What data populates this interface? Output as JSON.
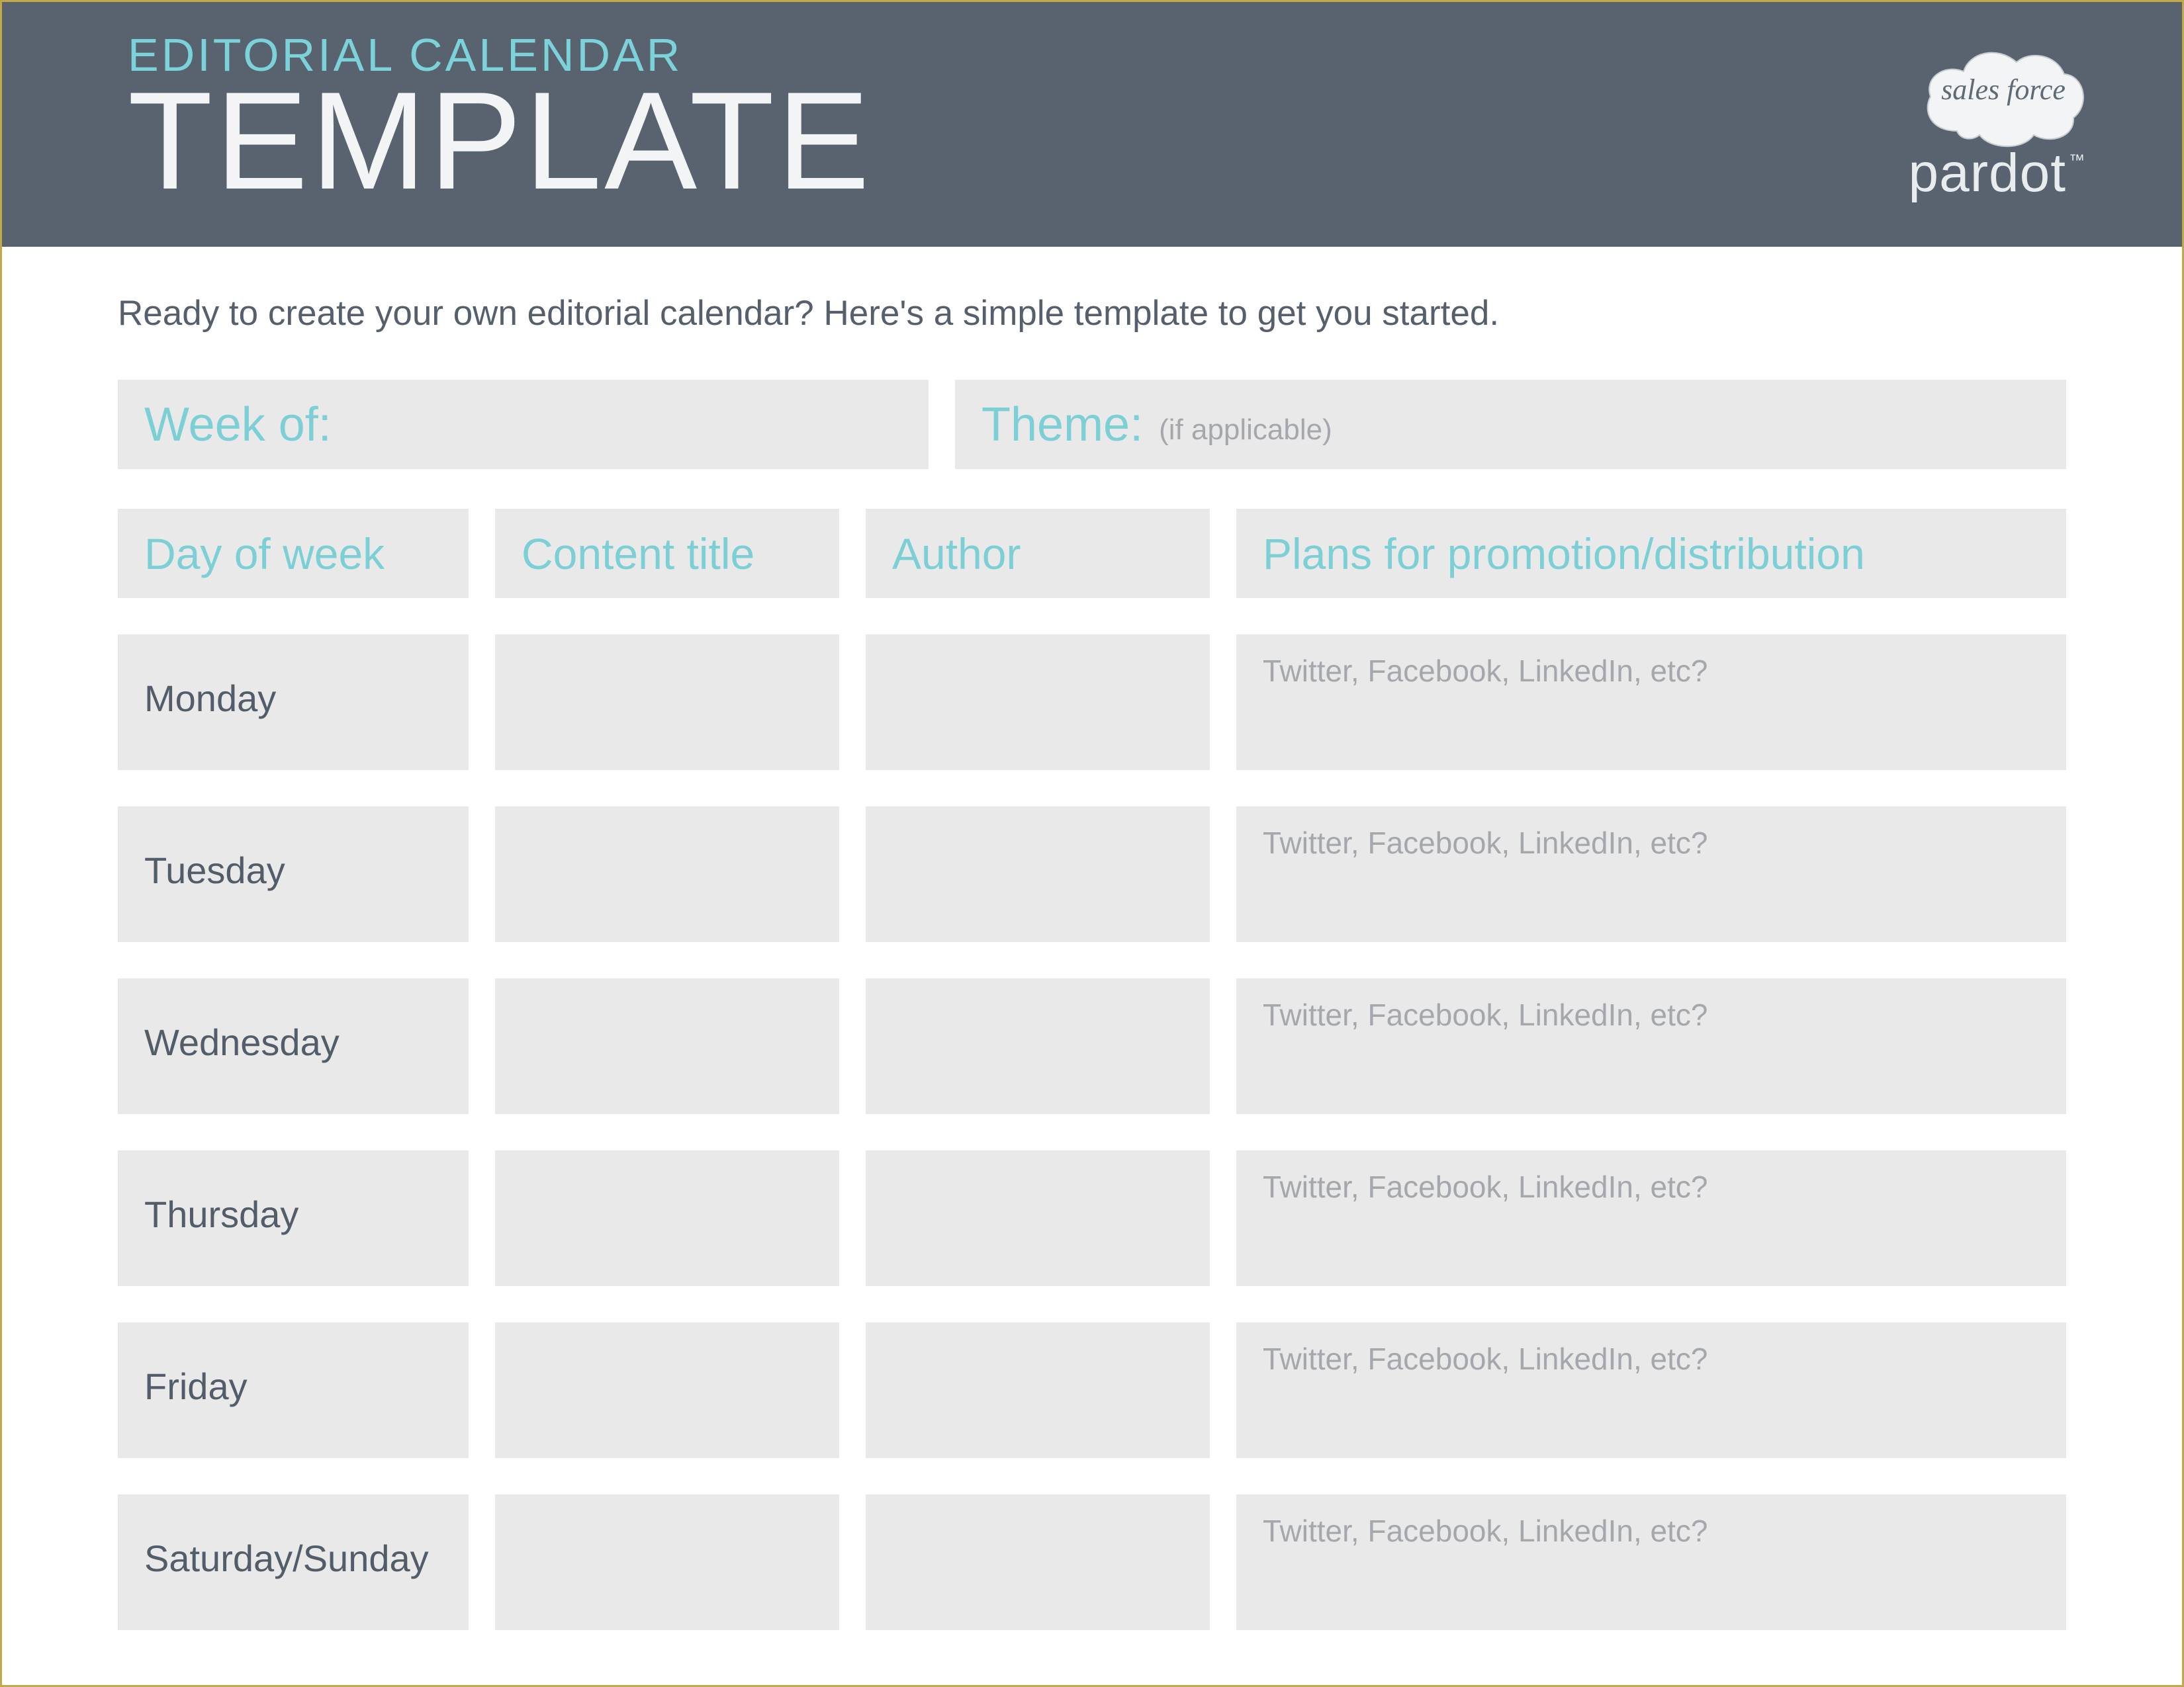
{
  "header": {
    "sup": "EDITORIAL CALENDAR",
    "title": "TEMPLATE"
  },
  "logo": {
    "brand_top": "salesforce",
    "brand_bottom": "pardot",
    "tm": "™"
  },
  "intro": "Ready to create your own editorial calendar? Here's a simple template to get you started.",
  "meta": {
    "week_label": "Week of:",
    "theme_label": "Theme:",
    "theme_hint": "(if applicable)"
  },
  "columns": {
    "day": "Day of week",
    "title": "Content title",
    "author": "Author",
    "plans": "Plans for promotion/distribution"
  },
  "rows": [
    {
      "day": "Monday",
      "title": "",
      "author": "",
      "plans": "Twitter, Facebook, LinkedIn, etc?"
    },
    {
      "day": "Tuesday",
      "title": "",
      "author": "",
      "plans": "Twitter, Facebook, LinkedIn, etc?"
    },
    {
      "day": "Wednesday",
      "title": "",
      "author": "",
      "plans": "Twitter, Facebook, LinkedIn, etc?"
    },
    {
      "day": "Thursday",
      "title": "",
      "author": "",
      "plans": "Twitter, Facebook, LinkedIn, etc?"
    },
    {
      "day": "Friday",
      "title": "",
      "author": "",
      "plans": "Twitter, Facebook, LinkedIn, etc?"
    },
    {
      "day": "Saturday/Sunday",
      "title": "",
      "author": "",
      "plans": "Twitter, Facebook, LinkedIn, etc?"
    }
  ],
  "colors": {
    "accent": "#7bd2d8",
    "header_bg": "#58636f",
    "cell_bg": "#e9e9ea",
    "border": "#c3a84a"
  }
}
